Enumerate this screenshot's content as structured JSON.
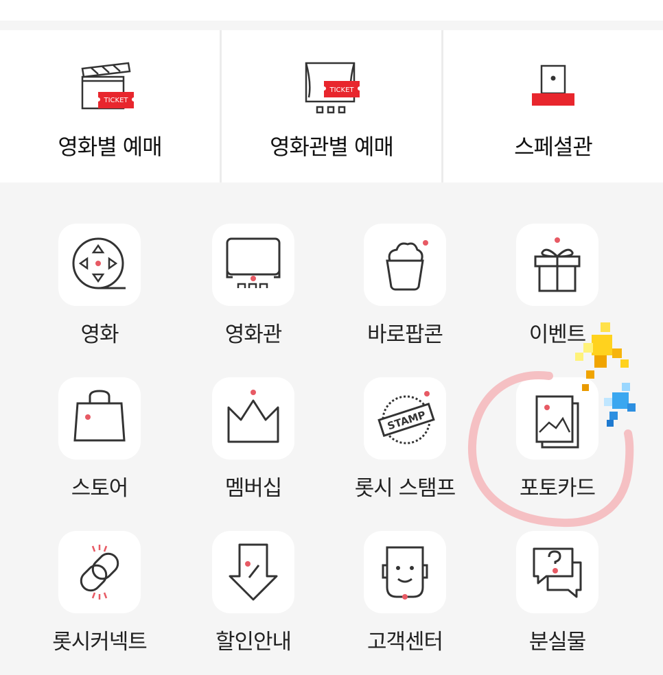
{
  "booking": {
    "items": [
      {
        "label": "영화별 예매",
        "icon": "film-clapper-ticket-icon"
      },
      {
        "label": "영화관별 예매",
        "icon": "theater-ticket-icon"
      },
      {
        "label": "스페셜관",
        "icon": "special-seat-icon"
      }
    ],
    "ticket_text": "TICKET"
  },
  "menu": {
    "items": [
      {
        "label": "영화",
        "icon": "film-reel-icon"
      },
      {
        "label": "영화관",
        "icon": "screen-icon"
      },
      {
        "label": "바로팝콘",
        "icon": "popcorn-icon"
      },
      {
        "label": "이벤트",
        "icon": "gift-icon"
      },
      {
        "label": "스토어",
        "icon": "shopping-bag-icon"
      },
      {
        "label": "멤버십",
        "icon": "crown-icon"
      },
      {
        "label": "롯시 스탬프",
        "icon": "stamp-icon"
      },
      {
        "label": "포토카드",
        "icon": "photo-card-icon"
      },
      {
        "label": "롯시커넥트",
        "icon": "link-icon"
      },
      {
        "label": "할인안내",
        "icon": "discount-arrow-icon"
      },
      {
        "label": "고객센터",
        "icon": "headset-face-icon"
      },
      {
        "label": "분실물",
        "icon": "speech-bubble-question-icon"
      }
    ],
    "stamp_text": "STAMP"
  },
  "colors": {
    "accent": "#e8262d",
    "dot": "#e75a64",
    "icon_stroke": "#333333",
    "highlight_circle": "#f5c0c3"
  }
}
